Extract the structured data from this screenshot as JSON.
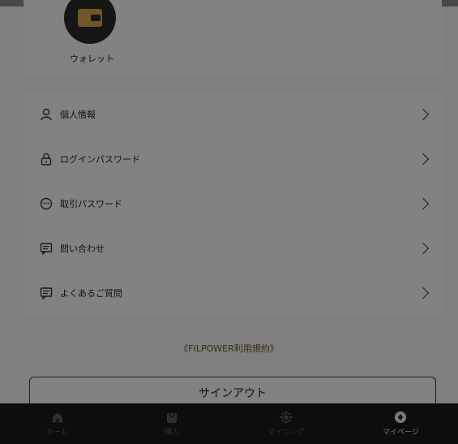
{
  "wallet": {
    "label": "ウォレット",
    "icon": "wallet-icon"
  },
  "menu": {
    "items": [
      {
        "label": "個人情報",
        "icon": "user-icon"
      },
      {
        "label": "ログインパスワード",
        "icon": "lock-icon"
      },
      {
        "label": "取引パスワード",
        "icon": "password-icon"
      },
      {
        "label": "問い合わせ",
        "icon": "message-icon"
      },
      {
        "label": "よくあるご質問",
        "icon": "faq-icon"
      }
    ]
  },
  "terms": {
    "label": "《FILPOWER利用規約》"
  },
  "signout": {
    "label": "サインアウト"
  },
  "tabbar": {
    "tabs": [
      {
        "label": "ホーム",
        "icon": "home-icon"
      },
      {
        "label": "購入",
        "icon": "purchase-icon"
      },
      {
        "label": "マイニング",
        "icon": "mining-icon"
      },
      {
        "label": "マイページ",
        "icon": "mypage-icon"
      }
    ],
    "active_index": 3
  },
  "colors": {
    "accent": "#d8a64e",
    "overlay": "rgba(0,0,0,0.48)",
    "tabbar_bg": "#191919"
  }
}
